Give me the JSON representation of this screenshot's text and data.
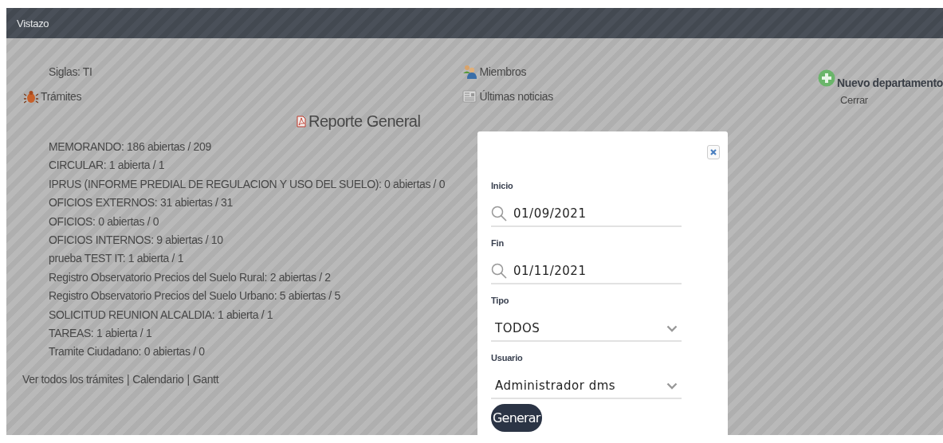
{
  "header": {
    "title": "Vistazo"
  },
  "department": {
    "acronym": "Siglas: TI",
    "procedures_link": "Trámites",
    "members_link": "Miembros",
    "news_link": "Últimas noticias",
    "new_department_button": "Nuevo departamento",
    "close_link": "Cerrar"
  },
  "report": {
    "title": "Reporte General",
    "counts": [
      {
        "text": "MEMORANDO: 186 abiertas / 209"
      },
      {
        "text": "CIRCULAR: 1 abierta / 1"
      },
      {
        "text": "IPRUS (INFORME PREDIAL DE REGULACION Y USO DEL SUELO): 0 abiertas / 0"
      },
      {
        "text": "OFICIOS EXTERNOS: 31 abiertas / 31"
      },
      {
        "text": "OFICIOS: 0 abiertas / 0"
      },
      {
        "text": "OFICIOS INTERNOS: 9 abiertas / 10"
      },
      {
        "text": "prueba TEST IT: 1 abierta / 1"
      },
      {
        "text": "Registro Observatorio Precios del Suelo Rural: 2 abiertas / 2"
      },
      {
        "text": "Registro Observatorio Precios del Suelo Urbano: 5 abiertas / 5"
      },
      {
        "text": "SOLICITUD REUNION ALCALDIA: 1 abierta / 1"
      },
      {
        "text": "TAREAS: 1 abierta / 1"
      },
      {
        "text": "Tramite Ciudadano: 0 abiertas / 0"
      }
    ]
  },
  "footer_links": [
    {
      "label": "Ver todos los trámites"
    },
    {
      "label": "Calendario"
    },
    {
      "label": "Gantt"
    }
  ],
  "link_separator": "|",
  "modal": {
    "fields": [
      {
        "kind": "date",
        "label": "Inicio",
        "value": "01/09/2021"
      },
      {
        "kind": "date",
        "label": "Fin",
        "value": "01/11/2021"
      },
      {
        "kind": "select",
        "label": "Tipo",
        "value": "TODOS"
      },
      {
        "kind": "select",
        "label": "Usuario",
        "value": "Administrador dms"
      }
    ],
    "submit_button": "Generar"
  }
}
